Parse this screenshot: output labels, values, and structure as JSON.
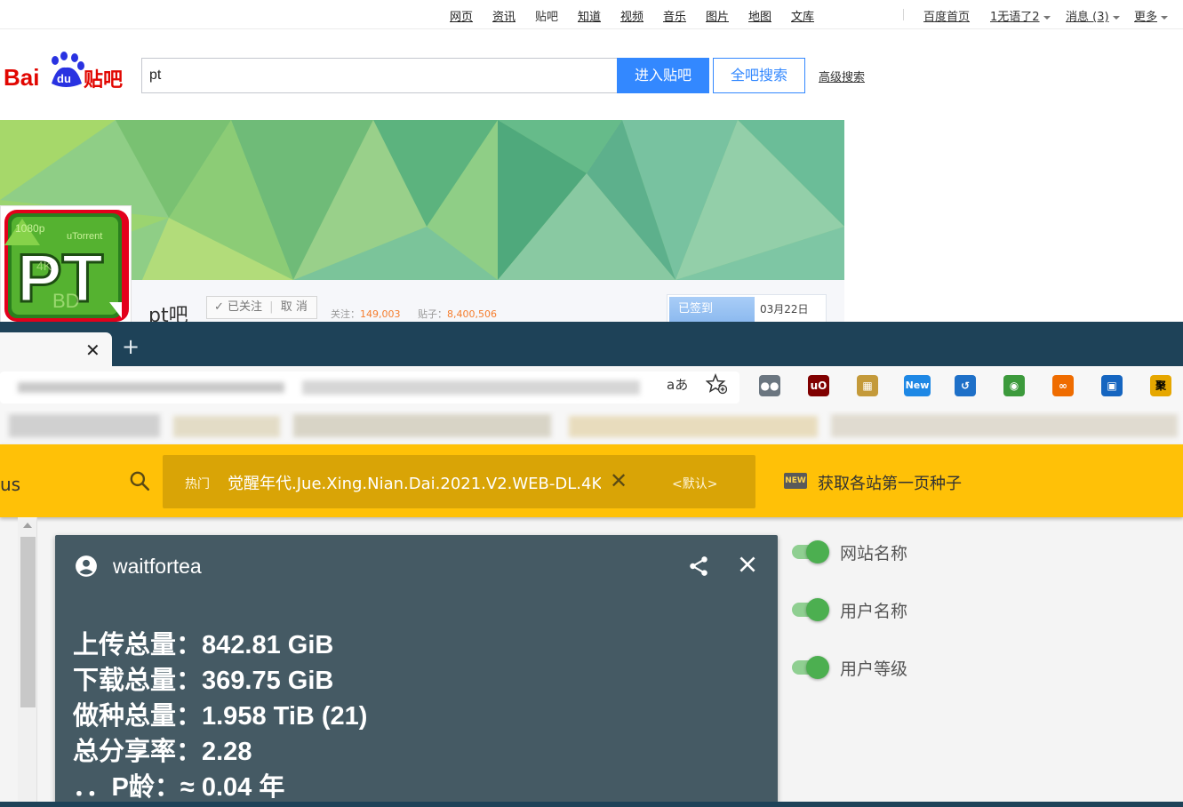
{
  "tieba": {
    "nav_links": [
      "网页",
      "资讯",
      "贴吧",
      "知道",
      "视频",
      "音乐",
      "图片",
      "地图",
      "文库"
    ],
    "nav_right": {
      "home": "百度首页",
      "user": "1无语了2",
      "messages": "消息 (3)",
      "more": "更多"
    },
    "logo_text": {
      "bai": "Bai",
      "du": "du",
      "tieba": "贴吧"
    },
    "search": {
      "value": "pt",
      "enter_label": "进入贴吧",
      "all_label": "全吧搜索",
      "advanced_label": "高级搜索"
    },
    "forum": {
      "name": "pt吧",
      "follow_label": "✓ 已关注",
      "unfollow_label": "取 消",
      "followers_label": "关注：",
      "followers": "149,003",
      "posts_label": "贴子：",
      "posts": "8,400,506",
      "signed_label": "已签到",
      "date": "03月22日"
    }
  },
  "browser": {
    "read_aloud": "aあ",
    "extensions": [
      {
        "name": "ghostery",
        "color": "#6b7680",
        "text": "●●"
      },
      {
        "name": "ublock",
        "color": "#800000",
        "text": "uO"
      },
      {
        "name": "tv",
        "color": "#c49a3a",
        "text": "▦"
      },
      {
        "name": "new",
        "color": "#1e88e5",
        "text": "New"
      },
      {
        "name": "history",
        "color": "#1e70c8",
        "text": "↺"
      },
      {
        "name": "globe",
        "color": "#3c9a3c",
        "text": "◉"
      },
      {
        "name": "infinity",
        "color": "#ef6c00",
        "text": "∞"
      },
      {
        "name": "trello",
        "color": "#1565c0",
        "text": "▣"
      },
      {
        "name": "ju",
        "color": "#e6a700",
        "text": "聚"
      }
    ]
  },
  "plugin": {
    "left_fragment": "us",
    "hot_label": "热门",
    "search_query": "觉醒年代.Jue.Xing.Nian.Dai.2021.V2.WEB-DL.4K",
    "default_label": "<默认>",
    "new_badge": "NEW",
    "fetch_label": "获取各站第一页种子",
    "card": {
      "username": "waitfortea",
      "stats": [
        "上传总量：842.81 GiB",
        "下载总量：369.75 GiB",
        "做种总量：1.958 TiB (21)",
        "总分享率：2.28",
        "．．P龄：≈ 0.04 年"
      ]
    },
    "options": [
      {
        "label": "网站名称",
        "enabled": true
      },
      {
        "label": "用户名称",
        "enabled": true
      },
      {
        "label": "用户等级",
        "enabled": true
      }
    ]
  }
}
